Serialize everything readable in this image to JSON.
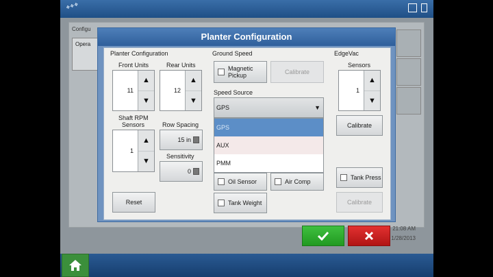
{
  "background": {
    "panel_title": "Configu",
    "panel_box_text": "Opera",
    "time": "21:08 AM",
    "date": "1/28/2013"
  },
  "dialog": {
    "title": "Planter Configuration",
    "planter": {
      "section_label": "Planter Configuration",
      "front_units_label": "Front Units",
      "front_units_value": "11",
      "rear_units_label": "Rear Units",
      "rear_units_value": "12",
      "shaft_rpm_label_line1": "Shaft RPM",
      "shaft_rpm_label_line2": "Sensors",
      "shaft_rpm_value": "1",
      "row_spacing_label": "Row Spacing",
      "row_spacing_value": "15 in",
      "sensitivity_label": "Sensitivity",
      "sensitivity_value": "0",
      "reset_label": "Reset"
    },
    "ground_speed": {
      "section_label": "Ground Speed",
      "magnetic_pickup_line1": "Magnetic",
      "magnetic_pickup_line2": "Pickup",
      "calibrate_label": "Calibrate",
      "speed_source_label": "Speed Source",
      "speed_source_selected": "GPS",
      "speed_source_options": [
        "GPS",
        "AUX",
        "PMM"
      ],
      "oil_sensor_label": "Oil Sensor",
      "air_comp_label": "Air Comp",
      "tank_weight_label": "Tank Weight"
    },
    "edgevac": {
      "section_label": "EdgeVac",
      "sensors_label": "Sensors",
      "sensors_value": "1",
      "calibrate_label": "Calibrate",
      "tank_press_label": "Tank Press",
      "calibrate2_label": "Calibrate"
    }
  },
  "icons": {
    "ok": "check-icon",
    "cancel": "x-icon",
    "home": "home-icon",
    "up": "up-arrow-icon",
    "down": "down-arrow-icon",
    "calculator": "calculator-icon"
  },
  "colors": {
    "ok_green": "#2aa52a",
    "cancel_red": "#c81e1e",
    "title_blue": "#3d6ea8",
    "selected_option": "#5c8ec7"
  }
}
